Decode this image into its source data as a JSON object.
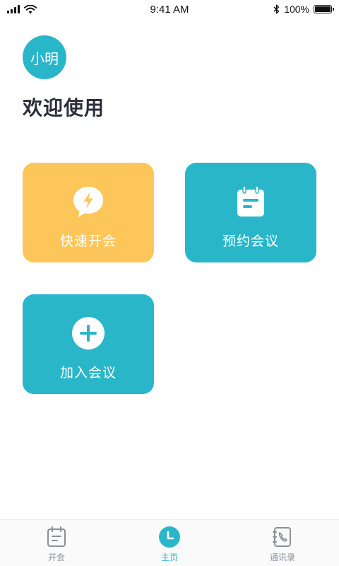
{
  "status_bar": {
    "time": "9:41 AM",
    "battery": "100%",
    "battery_level": 1.0,
    "icons": [
      "signal-icon",
      "wifi-icon",
      "bluetooth-icon",
      "battery-icon"
    ]
  },
  "user": {
    "avatar_text": "小明"
  },
  "page": {
    "title": "欢迎使用"
  },
  "actions": [
    {
      "label": "快速开会",
      "icon": "lightning-chat-icon",
      "color": "#fdc65a"
    },
    {
      "label": "预约会议",
      "icon": "calendar-note-icon",
      "color": "#2ab6c9"
    },
    {
      "label": "加入会议",
      "icon": "plus-circle-icon",
      "color": "#2ab6c9"
    }
  ],
  "tabs": [
    {
      "label": "开会",
      "icon": "calendar-icon",
      "active": false
    },
    {
      "label": "主页",
      "icon": "clock-icon",
      "active": true
    },
    {
      "label": "通讯录",
      "icon": "contacts-phone-icon",
      "active": false
    }
  ],
  "colors": {
    "accent": "#2ab6c9",
    "yellow": "#fdc65a",
    "title_text": "#2b2f3a",
    "inactive_tab": "#8a8f99"
  }
}
